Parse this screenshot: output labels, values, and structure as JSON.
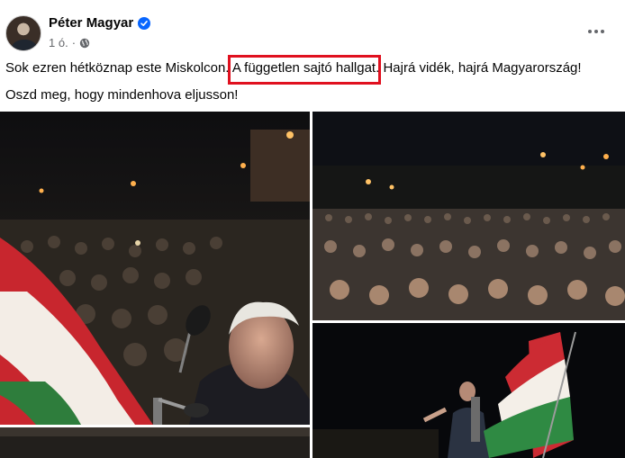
{
  "post": {
    "author": "Péter Magyar",
    "time": "1 ó.",
    "text_line_1_before": "Sok ezren hétköznap este Miskolcon. ",
    "text_line_1_highlight": "A független sajtó hallgat.",
    "text_line_1_after": " Hajrá vidék, hajrá Magyarország!",
    "text_line_2": "Oszd meg, hogy mindenhova eljusson!"
  },
  "icons": {
    "verified": "verified-badge-icon",
    "audience": "globe-icon",
    "menu": "more-options-icon"
  },
  "colors": {
    "verified_blue": "#0866ff",
    "highlight_red": "#e0101f",
    "meta_gray": "#65676b"
  },
  "photos": [
    {
      "label": "photo-speaker-with-flag"
    },
    {
      "label": "photo-crowd-night"
    },
    {
      "label": "photo-speaker-flag-stage"
    },
    {
      "label": "photo-more"
    }
  ]
}
